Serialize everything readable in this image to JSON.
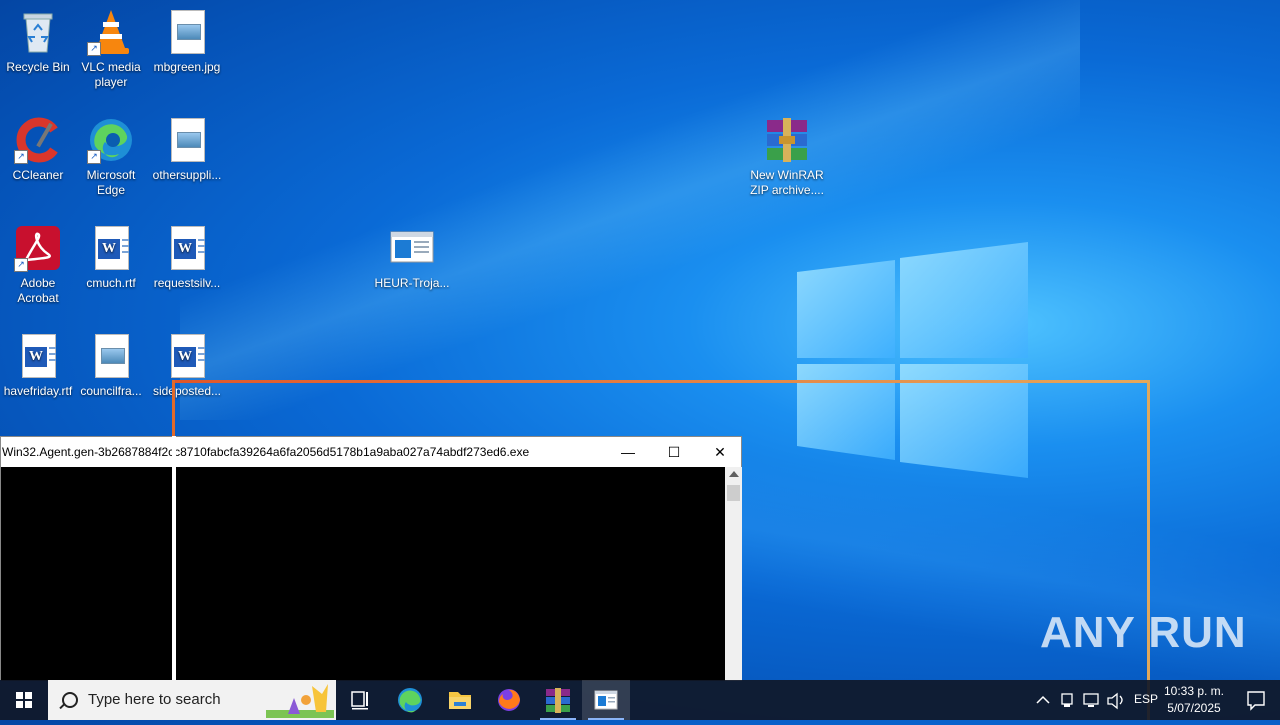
{
  "desktop": {
    "icons": [
      {
        "label": "Recycle Bin"
      },
      {
        "label": "VLC media player"
      },
      {
        "label": "mbgreen.jpg"
      },
      {
        "label": "CCleaner"
      },
      {
        "label": "Microsoft Edge"
      },
      {
        "label": "othersuppli..."
      },
      {
        "label": "Adobe Acrobat"
      },
      {
        "label": "cmuch.rtf"
      },
      {
        "label": "requestsilv..."
      },
      {
        "label": "HEUR-Troja..."
      },
      {
        "label": "New WinRAR ZIP archive...."
      },
      {
        "label": "havefriday.rtf"
      },
      {
        "label": "councilfra..."
      },
      {
        "label": "sideposted..."
      }
    ]
  },
  "window": {
    "title": "Win32.Agent.gen-3b2687884f2cc8710fabcfa39264a6fa2056d5178b1a9aba027a74abdf273ed6.exe",
    "minimize": "—",
    "maximize": "☐",
    "close": "✕"
  },
  "taskbar": {
    "search_placeholder": "Type here to search",
    "lang": "ESP",
    "time": "10:33 p. m.",
    "date": "5/07/2025"
  },
  "watermark": "ANY RUN"
}
